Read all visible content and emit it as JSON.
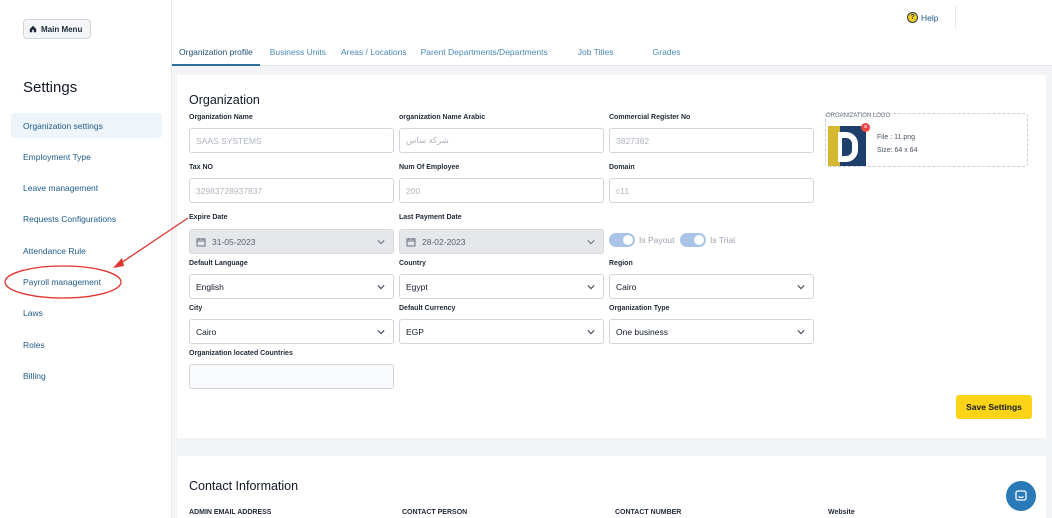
{
  "sidebar": {
    "main_menu_label": "Main Menu",
    "title": "Settings",
    "items": [
      {
        "label": "Organization settings",
        "active": true
      },
      {
        "label": "Employment Type"
      },
      {
        "label": "Leave management"
      },
      {
        "label": "Requests Configurations"
      },
      {
        "label": "Attendance Rule"
      },
      {
        "label": "Payroll management"
      },
      {
        "label": "Laws"
      },
      {
        "label": "Roles"
      },
      {
        "label": "Billing"
      }
    ]
  },
  "header": {
    "help_label": "Help",
    "tabs": [
      {
        "label": "Organization profile",
        "active": true
      },
      {
        "label": "Business Units"
      },
      {
        "label": "Areas / Locations"
      },
      {
        "label": "Parent Departments/Departments"
      },
      {
        "label": "Job Titles"
      },
      {
        "label": "Grades"
      }
    ]
  },
  "organization": {
    "title": "Organization",
    "org_name": {
      "label": "Organization Name",
      "value": "SAAS SYSTEMS"
    },
    "org_name_ar": {
      "label": "organization Name Arabic",
      "value": "شركة ساس"
    },
    "commercial_register": {
      "label": "Commercial Register No",
      "value": "3827382"
    },
    "tax_no": {
      "label": "Tax NO",
      "value": "32983728937837"
    },
    "num_employee": {
      "label": "Num Of Employee",
      "value": "200"
    },
    "domain": {
      "label": "Domain",
      "value": "c11"
    },
    "expire_date": {
      "label": "Expire Date",
      "value": "31-05-2023"
    },
    "last_payment_date": {
      "label": "Last Payment Date",
      "value": "28-02-2023"
    },
    "is_payout_label": "Is Payout",
    "is_trial_label": "Is Trial",
    "default_language": {
      "label": "Default Language",
      "value": "English"
    },
    "country": {
      "label": "Country",
      "value": "Egypt"
    },
    "region": {
      "label": "Region",
      "value": "Cairo"
    },
    "city": {
      "label": "City",
      "value": "Cairo"
    },
    "default_currency": {
      "label": "Default Currency",
      "value": "EGP"
    },
    "org_type": {
      "label": "Organization Type",
      "value": "One business"
    },
    "located_countries": {
      "label": "Organization located Countries",
      "value": ""
    },
    "logo": {
      "caption": "ORGANIZATION LOGO",
      "file": "File : 11.png",
      "size": "Size: 64 x 64"
    },
    "save_label": "Save Settings"
  },
  "contact": {
    "title": "Contact Information",
    "columns": [
      "ADMIN EMAIL ADDRESS",
      "CONTACT PERSON",
      "CONTACT NUMBER",
      "Website"
    ]
  },
  "colors": {
    "accent": "#2b6f9e",
    "save_button": "#fbd317",
    "annotation": "#e3342f"
  }
}
